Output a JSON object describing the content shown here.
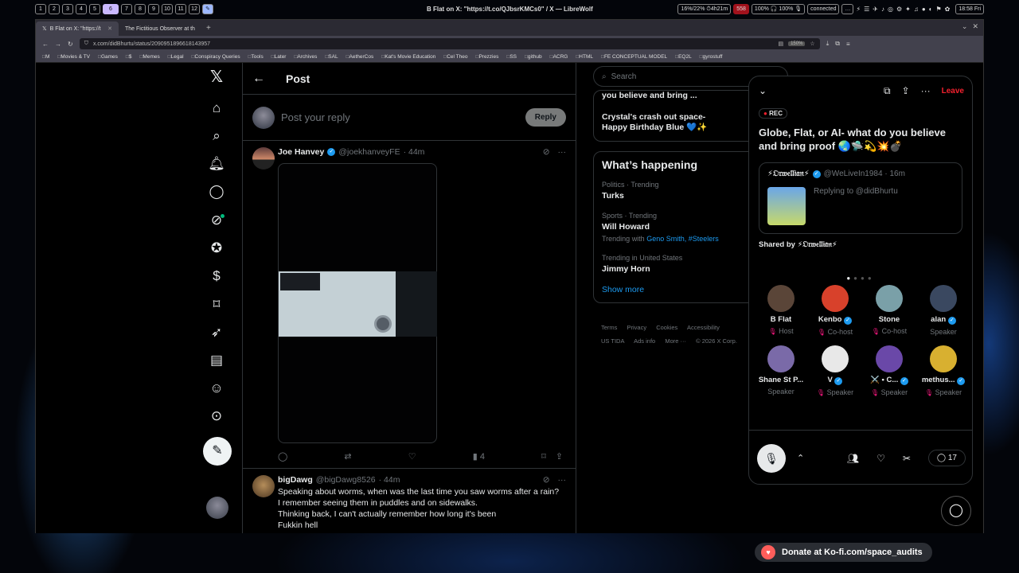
{
  "sysbar": {
    "workspaces": [
      "1",
      "2",
      "3",
      "4",
      "5",
      "6",
      "7",
      "8",
      "9",
      "10",
      "11",
      "12"
    ],
    "active_workspace": "6",
    "window_title": "B Flat on X: \"https://t.co/QJbsrKMCs0\" / X — LibreWolf",
    "battery": "16%/22% ⏱4h21m",
    "notifications": "558",
    "volume": "100% 🎧 100% 🎙",
    "vpn": "connected",
    "clock": "18:58 Fri"
  },
  "browser": {
    "tabs": [
      {
        "label": "B Flat on X: \"https://t"
      },
      {
        "label": "The Fictitious Observer at th"
      }
    ],
    "url": "x.com/didBhurtu/status/2090951896618143957",
    "zoom": "150%",
    "bookmarks": [
      "M",
      "Movies & TV",
      "Games",
      "$",
      "Memes",
      "Legal",
      "Conspiracy Queries",
      "Tools",
      "Later",
      "Archives",
      "SAL",
      "AetherCos",
      "Kat's Movie Education",
      "Cel Theo",
      "Prezzies",
      "SS",
      "github",
      "ACRG",
      "HTML",
      "FE CONCEPTUAL MODEL",
      "EQ2L",
      "gyrostuff"
    ]
  },
  "main": {
    "header_title": "Post",
    "reply_placeholder": "Post your reply",
    "reply_button": "Reply",
    "tweets": [
      {
        "name": "Joe Hanvey",
        "handle": "@joekhanveyFE",
        "time": "· 44m",
        "views": "4",
        "body": ""
      },
      {
        "name": "bigDawg",
        "handle": "@bigDawg8526",
        "time": "· 44m",
        "body_lines": [
          "Speaking about worms, when was the last time you saw worms after a rain?",
          "I remember seeing them in puddles and on sidewalks.",
          "Thinking back, I can't actually remember how long it's been",
          "Fukkin hell"
        ]
      }
    ]
  },
  "right": {
    "search_placeholder": "Search",
    "prev_card_line1": "you believe and bring ...",
    "prev_card_line2": "Crystal's crash out space-",
    "prev_card_line3": "Happy Birthday Blue 💙✨",
    "happening_title": "What’s happening",
    "trends": [
      {
        "context": "Politics · Trending",
        "name": "Turks"
      },
      {
        "context": "Sports · Trending",
        "name": "Will Howard",
        "with_prefix": "Trending with",
        "with_links": "Geno Smith, #Steelers"
      },
      {
        "context": "Trending in United States",
        "name": "Jimmy Horn"
      }
    ],
    "show_more": "Show more",
    "footer_row1": [
      "Terms",
      "Privacy",
      "Cookies",
      "Accessibility"
    ],
    "footer_row2": [
      "US TIDA",
      "Ads info",
      "More ···",
      "© 2026 X Corp."
    ]
  },
  "space": {
    "leave": "Leave",
    "rec": "REC",
    "title": "Globe, Flat, or AI- what do you believe and bring proof 🌏🛸💫💥💣",
    "shared_name": "⚡𝔒𝔯𝔴𝔢𝔩𝔩𝔦𝔞𝔫⚡",
    "shared_handle": "@WeLiveIn1984 · 16m",
    "shared_replying": "Replying to @didBhurtu",
    "shared_by": "Shared by ⚡𝔒𝔯𝔴𝔢𝔩𝔩𝔦𝔞𝔫⚡",
    "participants": [
      {
        "name": "B Flat",
        "role": "Host",
        "muted": true,
        "color": "#5a4538"
      },
      {
        "name": "Kenbo",
        "role": "Co-host",
        "muted": true,
        "verified": true,
        "color": "#d8412b"
      },
      {
        "name": "Stone",
        "role": "Co-host",
        "muted": true,
        "color": "#7aa0a8"
      },
      {
        "name": "alan",
        "role": "Speaker",
        "muted": false,
        "verified": true,
        "color": "#3a4860"
      },
      {
        "name": "Shane St P...",
        "role": "Speaker",
        "muted": false,
        "color": "#7a6aa8"
      },
      {
        "name": "V",
        "role": "Speaker",
        "muted": true,
        "verified": true,
        "color": "#e8e8e8"
      },
      {
        "name": "⚔️ • C...",
        "role": "Speaker",
        "muted": true,
        "verified": true,
        "color": "#6a48a8"
      },
      {
        "name": "methus...",
        "role": "Speaker",
        "muted": true,
        "verified": true,
        "color": "#d8b030"
      }
    ],
    "comment_count": "17"
  },
  "kofi_text": "Donate at Ko-fi.com/space_audits"
}
